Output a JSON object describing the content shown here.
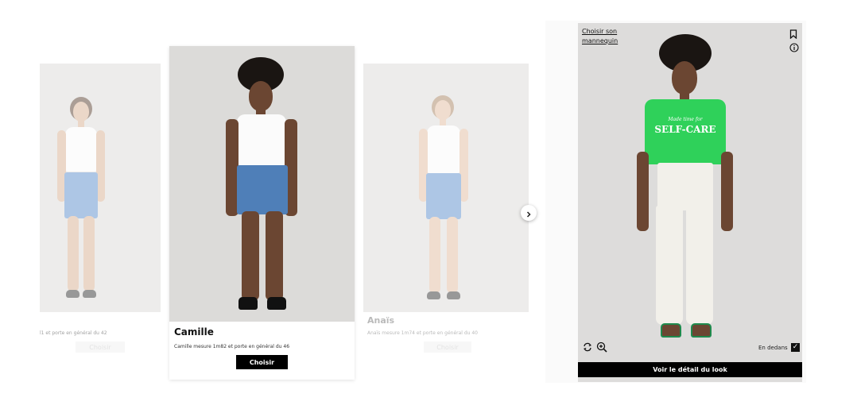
{
  "carousel": {
    "cards": [
      {
        "id": "left",
        "name": "",
        "description": "l1 et porte en général du 42",
        "choose_label": "Choisir"
      },
      {
        "id": "main",
        "name": "Camille",
        "description": "Camille mesure 1m82 et porte en général du 46",
        "choose_label": "Choisir"
      },
      {
        "id": "right",
        "name": "Anaïs",
        "description": "Anaïs mesure 1m74 et porte en général du 40",
        "choose_label": "Choisir"
      }
    ],
    "next_icon": "chevron-right-icon"
  },
  "tryon": {
    "choose_model_link": "Choisir son mannequin",
    "bookmark_icon": "bookmark-icon",
    "info_icon": "info-icon",
    "rotate_icon": "rotate-icon",
    "zoom_icon": "zoom-in-icon",
    "tuck_label": "En dedans",
    "tuck_checked": true,
    "shirt_script": "Made time for",
    "shirt_text": "SELF-CARE",
    "detail_button_label": "Voir le détail du look"
  },
  "colors": {
    "shirt_green": "#2fd15a",
    "denim": "#4f7fb8",
    "white_pants": "#f2f0ea",
    "button_black": "#000000"
  }
}
